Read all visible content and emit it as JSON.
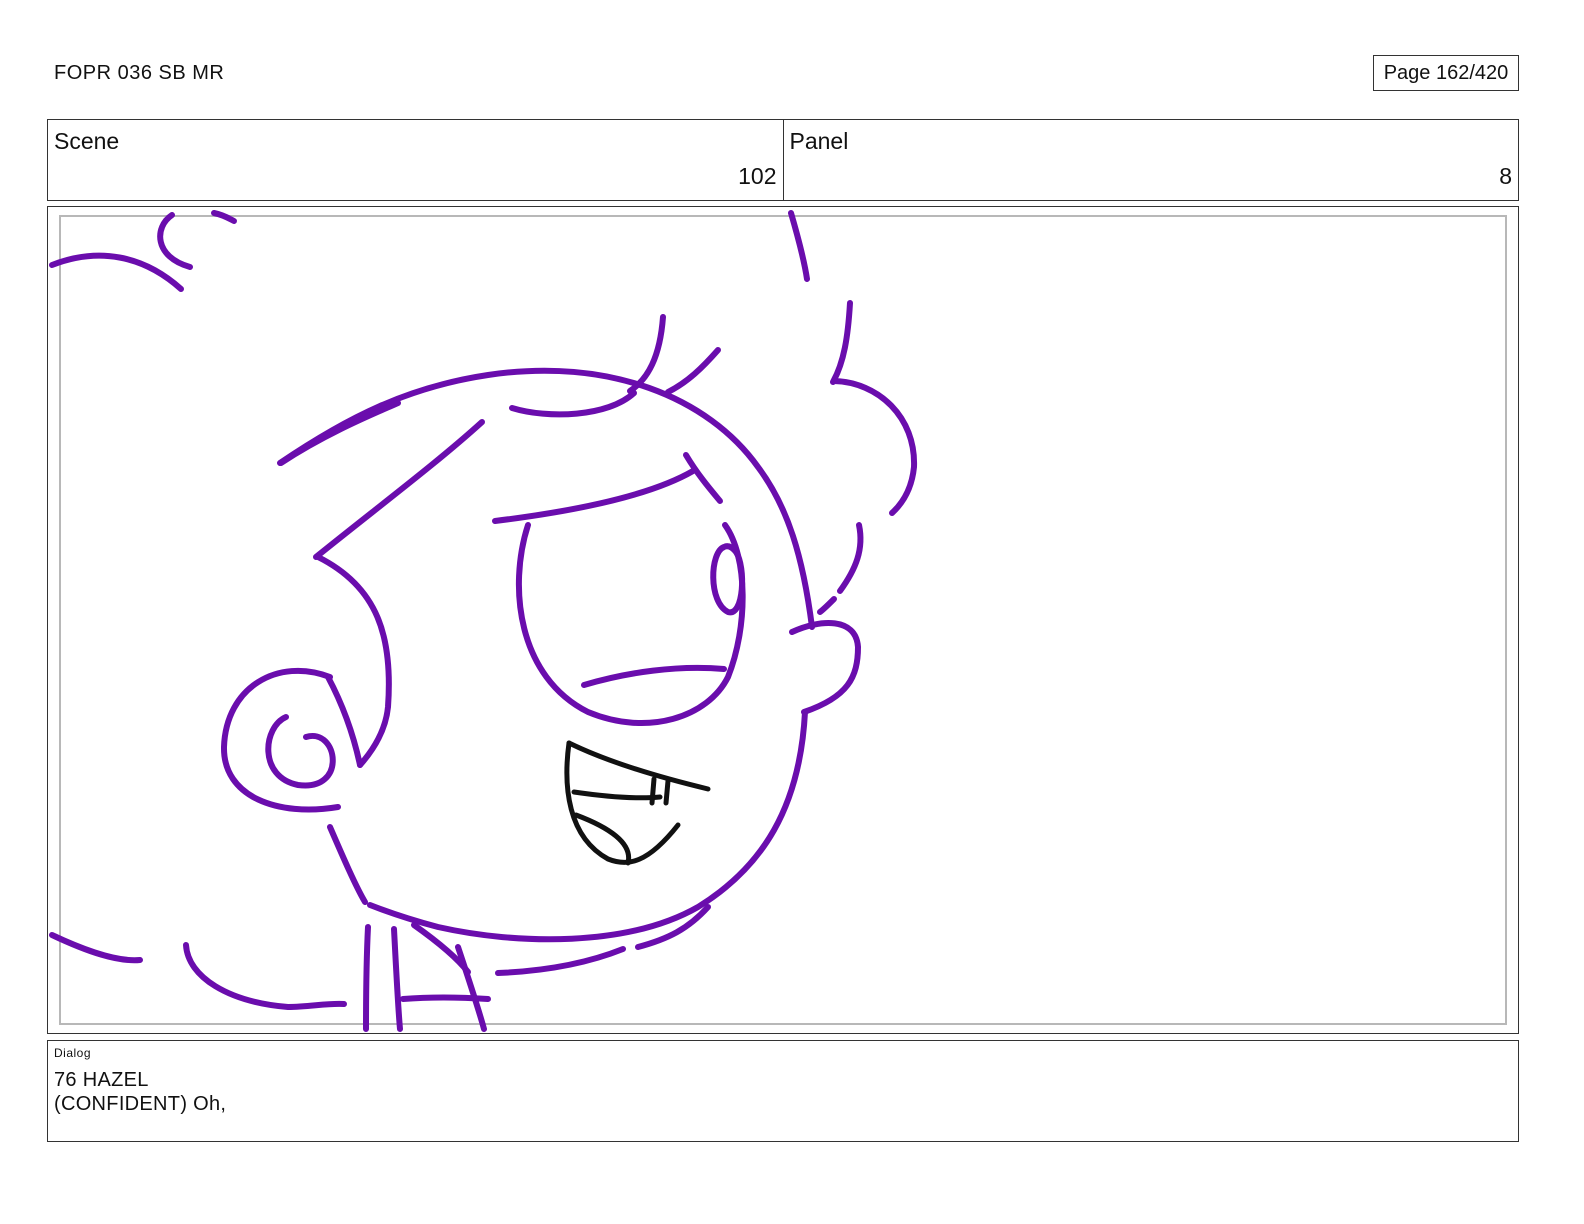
{
  "header": {
    "doc_title": "FOPR 036 SB MR",
    "page_label": "Page 162/420"
  },
  "info": {
    "scene_label": "Scene",
    "scene_value": "102",
    "panel_label": "Panel",
    "panel_value": "8"
  },
  "panel": {
    "line_color": "#6a0dad",
    "mouth_color": "#111111",
    "subject": "cartoon character head, smiling"
  },
  "dialog": {
    "label": "Dialog",
    "lines": [
      "76 HAZEL",
      "(CONFIDENT) Oh,"
    ]
  }
}
